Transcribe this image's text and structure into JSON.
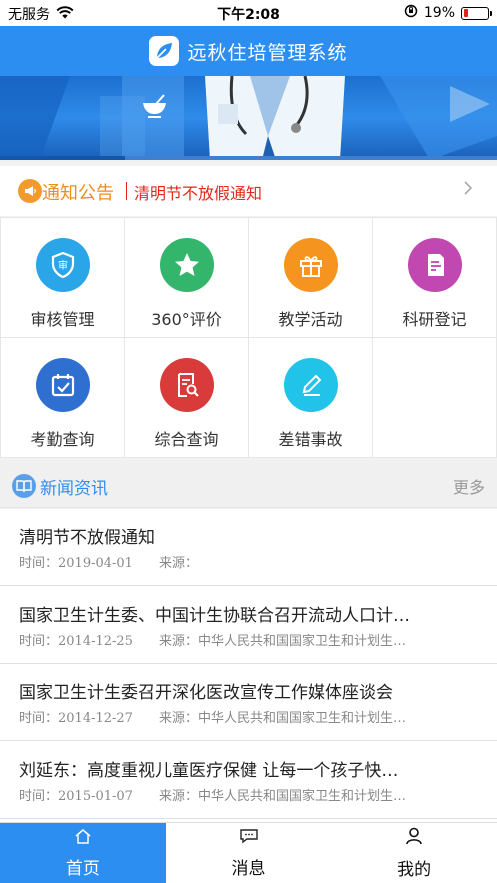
{
  "status_bar": {
    "carrier": "无服务",
    "time": "下午2:08",
    "battery": "19%",
    "battery_level": 0.19
  },
  "header": {
    "title": "远秋住培管理系统",
    "logo_icon": "leaf-icon"
  },
  "notice": {
    "label": "通知公告",
    "text": "清明节不放假通知",
    "icon": "megaphone-icon"
  },
  "grid": [
    {
      "label": "审核管理",
      "icon": "shield-check-icon",
      "color": "#2aa6e8"
    },
    {
      "label": "360°评价",
      "icon": "star-icon",
      "color": "#33b56b"
    },
    {
      "label": "教学活动",
      "icon": "gift-icon",
      "color": "#f5951f"
    },
    {
      "label": "科研登记",
      "icon": "document-edit-icon",
      "color": "#c148b0"
    },
    {
      "label": "考勤查询",
      "icon": "calendar-check-icon",
      "color": "#2f6fd0"
    },
    {
      "label": "综合查询",
      "icon": "search-document-icon",
      "color": "#d93a3a"
    },
    {
      "label": "差错事故",
      "icon": "pencil-icon",
      "color": "#22c3e8"
    }
  ],
  "news": {
    "title": "新闻资讯",
    "more": "更多",
    "items": [
      {
        "title": "清明节不放假通知",
        "meta": "时间：2019-04-01",
        "source": "来源："
      },
      {
        "title": "国家卫生计生委、中国计生协联合召开流动人口计…",
        "meta": "时间：2014-12-25",
        "source": "来源：中华人民共和国国家卫生和计划生…"
      },
      {
        "title": "国家卫生计生委召开深化医改宣传工作媒体座谈会",
        "meta": "时间：2014-12-27",
        "source": "来源：中华人民共和国国家卫生和计划生…"
      },
      {
        "title": "刘延东：高度重视儿童医疗保健 让每一个孩子快…",
        "meta": "时间：2015-01-07",
        "source": "来源：中华人民共和国国家卫生和计划生…"
      }
    ]
  },
  "tabs": [
    {
      "label": "首页",
      "icon": "home-icon",
      "active": true
    },
    {
      "label": "消息",
      "icon": "message-icon",
      "active": false
    },
    {
      "label": "我的",
      "icon": "user-icon",
      "active": false
    }
  ]
}
